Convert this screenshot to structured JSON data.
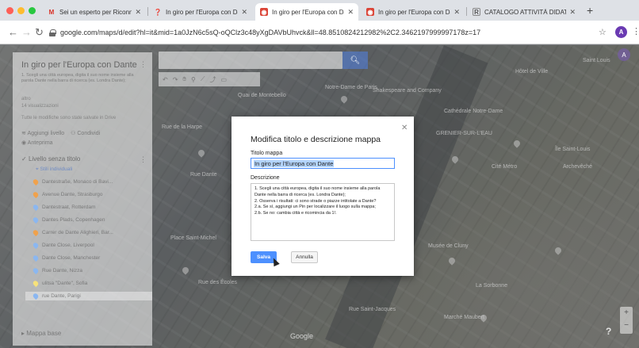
{
  "browser": {
    "tabs": [
      {
        "title": "Sei un esperto per Riconnessioni",
        "icon": "gmail-icon",
        "active": false
      },
      {
        "title": "In giro per l'Europa con Dante",
        "icon": "maps-pin-icon",
        "active": false
      },
      {
        "title": "In giro per l'Europa con Dante",
        "icon": "my-maps-icon",
        "active": true
      },
      {
        "title": "In giro per l'Europa con Dante",
        "icon": "my-maps-icon",
        "active": false
      },
      {
        "title": "CATALOGO ATTIVITÀ DIDATTICHE",
        "icon": "sheets-icon",
        "active": false
      }
    ],
    "url": "google.com/maps/d/edit?hl=it&mid=1a0JzN6c5sQ-oQClz3c48yXgDAVbUhvck&ll=48.8510824212982%2C2.3462197999997178z=17",
    "profile_initial": "A",
    "accent": "#4d90fe"
  },
  "panel": {
    "title": "In giro per l'Europa con Dante",
    "description": "1. Scegli una città europea, digita il suo nome insieme alla parola Dante nella barra di ricerca (es. Londra Dante);",
    "owner": "altro",
    "views": "14 visualizzazioni",
    "saved_note": "Tutte le modifiche sono state salvate in Drive",
    "add_layer": "Aggiungi livello",
    "share": "Condividi",
    "preview": "Anteprima",
    "layer_name": "Livello senza titolo",
    "layer_style": "Stili individuali",
    "items": [
      {
        "label": "Dantestraße, Monaco di Bavi...",
        "color": "#f0a24c"
      },
      {
        "label": "Avenue Dante, Strasburgo",
        "color": "#f0a24c"
      },
      {
        "label": "Dantestraat, Rotterdam",
        "color": "#8bb7f0"
      },
      {
        "label": "Dantes Plads, Copenhagen",
        "color": "#8bb7f0"
      },
      {
        "label": "Carrer de Dante Alighieri, Bar...",
        "color": "#f0a24c"
      },
      {
        "label": "Dante Close, Liverpool",
        "color": "#8bb7f0"
      },
      {
        "label": "Dante Close, Manchester",
        "color": "#8bb7f0"
      },
      {
        "label": "Rue Dante, Nizza",
        "color": "#8bb7f0"
      },
      {
        "label": "ulitsa \"Dante\", Sofia",
        "color": "#f7e27a"
      },
      {
        "label": "rue Dante, Parigi",
        "color": "#8bb7f0"
      }
    ],
    "base_map": "Mappa base"
  },
  "map_labels": [
    "Saint Louis",
    "Notre-Dame de Paris",
    "Shakespeare and Company",
    "Cathédrale Notre-Dame",
    "Rue de la Harpe",
    "GRENIER-SUR-L'EAU",
    "Hôtel de Ville",
    "Quai de Montebello",
    "Rue Dante",
    "Cité Métro",
    "Place Saint-Michel",
    "Musée de Cluny",
    "La Sorbonne",
    "Rue des Écoles",
    "Rue Saint-Jacques",
    "Marché Maubert",
    "Île Saint-Louis",
    "Archevêché"
  ],
  "map_brand": "Google",
  "dialog": {
    "title": "Modifica titolo e descrizione mappa",
    "title_label": "Titolo mappa",
    "title_value": "In giro per l'Europa con Dante",
    "desc_label": "Descrizione",
    "desc_value": "1. Scegli una città europea, digita il suo nome insieme alla parola Dante nella barra di ricerca (es. Londra Dante);\n2. Osserva i risultati: ci sono strade o piazze intitolate a Dante?\n2.a. Se sì, aggiungi un Pin per localizzare il luogo sulla mappa;\n2.b. Se no: cambia città e ricomincia da 1!.",
    "save": "Salva",
    "cancel": "Annulla"
  }
}
